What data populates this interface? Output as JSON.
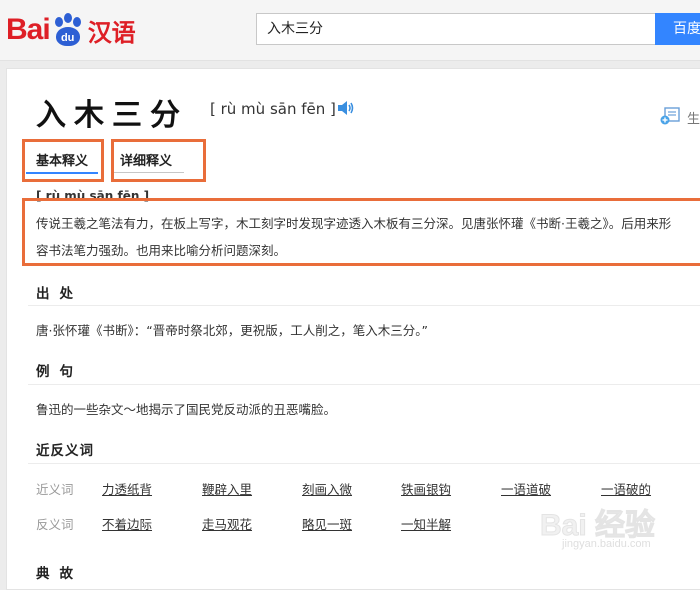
{
  "header": {
    "logo": {
      "bai": "Bai",
      "du": "du",
      "cn": "汉语"
    },
    "search_value": "入木三分",
    "search_button": "百度"
  },
  "word": {
    "title": "入木三分",
    "pinyin": "[ rù mù sān fēn ]",
    "generate_label": "生"
  },
  "tabs": [
    {
      "label": "基本释义",
      "active": true
    },
    {
      "label": "详细释义",
      "active": false
    }
  ],
  "basic": {
    "pinyin": "[ rù mù sān fēn ]",
    "lines": [
      "传说王羲之笔法有力，在板上写字，木工刻字时发现字迹透入木板有三分深。见唐张怀瓘《书断·王羲之》。后用来形",
      "容书法笔力强劲。也用来比喻分析问题深刻。"
    ]
  },
  "sections": {
    "source": {
      "title": "出处",
      "text": "唐·张怀瓘《书断》：“晋帝时祭北郊，更祝版，工人削之，笔入木三分。”"
    },
    "example": {
      "title": "例句",
      "text": "鲁迅的一些杂文～地揭示了国民党反动派的丑恶嘴脸。"
    },
    "synonyms": {
      "title": "近反义词",
      "syn_label": "近义词",
      "syn": [
        "力透纸背",
        "鞭辟入里",
        "刻画入微",
        "铁画银钩",
        "一语道破",
        "一语破的"
      ],
      "ant_label": "反义词",
      "ant": [
        "不着边际",
        "走马观花",
        "略见一斑",
        "一知半解"
      ]
    },
    "story": {
      "title": "典故"
    }
  },
  "watermark": {
    "text": "Bai 经验",
    "url": "jingyan.baidu.com"
  },
  "colors": {
    "brand_red": "#de1f26",
    "brand_blue": "#3385ff",
    "highlight": "#e96d3a"
  }
}
